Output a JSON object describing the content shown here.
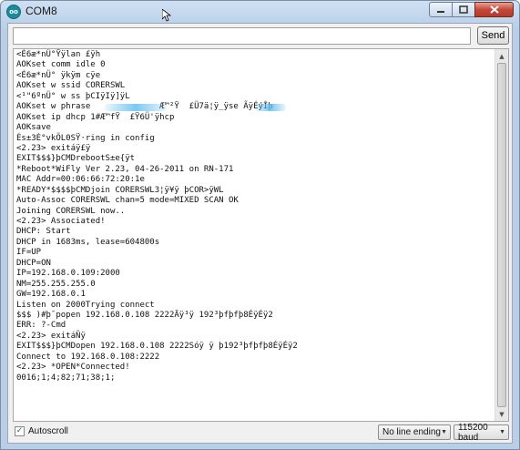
{
  "window": {
    "title": "COM8",
    "app_icon": "arduino-icon",
    "controls": {
      "minimize": "minimize-icon",
      "maximize": "maximize-icon",
      "close": "close-icon"
    }
  },
  "input": {
    "value": "",
    "send_label": "Send"
  },
  "output": {
    "lines": [
      "<É6æ*nÜ°Ÿÿlan £ÿh",
      "AOKset comm idle 0",
      "<É6æ*nÜ° ÿkÿm cÿe",
      "AOKset w ssid CORERSWL",
      "<¹\"6ºnÜ° w ss þCIÿIÿ]ÿL",
      "AOKset w phrase              Æ™²Ÿ  £Ü7ä¦ÿ_ÿse ÃÿÉýÎþ",
      "AOKset ip dhcp 1#Æ™fŸ  £Ÿ6Ü'ÿhcp",
      "AOKsave",
      "És±3È°vkÖL0SŸ·ring in config",
      "<2.23> exitáÿ£ÿ",
      "EXIT$$$}þCMDrebootS±e{ÿt",
      "*Reboot*WiFly Ver 2.23, 04-26-2011 on RN-171",
      "MAC Addr=00:06:66:72:20:1e",
      "*READY*$$$$þCMDjoin CORERSWL3¦ÿ¥ÿ þCOR>ÿWL",
      "Auto-Assoc CORERSWL chan=5 mode=MIXED SCAN OK",
      "Joining CORERSWL now..",
      "<2.23> Associated!",
      "DHCP: Start",
      "DHCP in 1683ms, lease=604800s",
      "IF=UP",
      "DHCP=ON",
      "IP=192.168.0.109:2000",
      "NM=255.255.255.0",
      "GW=192.168.0.1",
      "Listen on 2000Trying connect",
      "$$$ )#þ¯popen 192.168.0.108 2222Äÿ³ÿ 192³þfþfþ8ÉÿÉÿ2",
      "ERR: ?-Cmd",
      "<2.23> exitáÑÿ",
      "EXIT$$$}þCMDopen 192.168.0.108 2222Sóÿ ÿ þ192³þfþfþ8ÉÿÉÿ2",
      "Connect to 192.168.0.108:2222",
      "<2.23> *OPEN*Connected!",
      "0016;1;4;82;71;38;1;"
    ]
  },
  "footer": {
    "autoscroll_label": "Autoscroll",
    "autoscroll_checked": true,
    "line_ending": "No line ending",
    "baud": "115200 baud"
  },
  "colors": {
    "redaction": "#64bef0",
    "titlebar": "#b9cfe8",
    "close": "#c5493a"
  }
}
